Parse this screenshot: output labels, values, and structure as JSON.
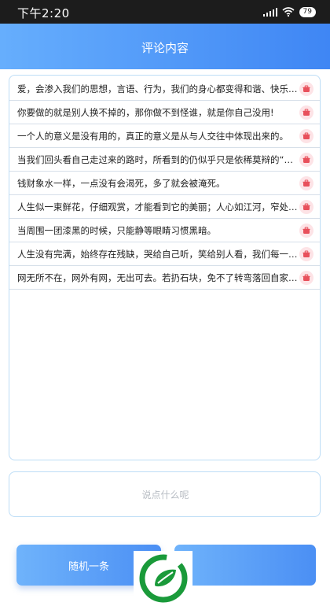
{
  "status_bar": {
    "time": "下午2:20",
    "battery": "79"
  },
  "header": {
    "title": "评论内容"
  },
  "comments": [
    "爱，会渗入我们的思想，言语、行为，我们的身心都变得和谐、快乐、轻…",
    "你要做的就是别人换不掉的，那你做不到怪谁，就是你自己没用!",
    "一个人的意义是没有用的，真正的意义是从与人交往中体现出来的。",
    "当我们回头看自己走过来的路时，所看到的仍似乎只是依稀莫辩的“或…",
    "钱财象水一样，一点没有会渴死，多了就会被淹死。",
    "人生似一束鲜花，仔细观赏，才能看到它的美丽；人心如江河，窄处水花…",
    "当周围一团漆黑的时候，只能静等眼睛习惯黑暗。",
    "人生没有完满，始终存在残缺，哭给自己听，笑给别人看，我们每一个人…",
    "网无所不在，网外有网，无出可去。若扔石块，免不了转弯落回自家头上…"
  ],
  "input": {
    "placeholder": "说点什么呢",
    "value": ""
  },
  "buttons": {
    "random": "随机一条"
  },
  "colors": {
    "accent": "#4b8ff4",
    "delete": "#e8505b",
    "logo": "#1a9a3a"
  }
}
